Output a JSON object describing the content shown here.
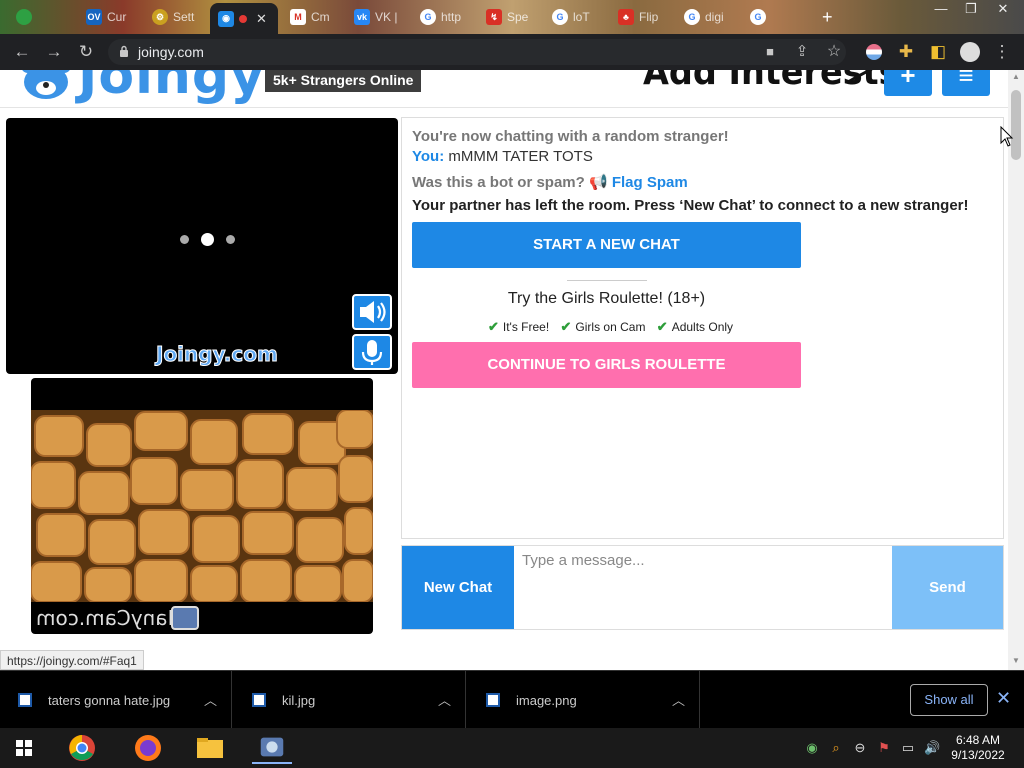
{
  "browser": {
    "tabs": [
      {
        "label": "",
        "icon": "green-dot-icon",
        "color": "#2ea043"
      },
      {
        "label": "Cur",
        "icon": "ov-icon",
        "color": "#1565c0"
      },
      {
        "label": "Sett",
        "icon": "gear-icon",
        "color": "#caa020"
      },
      {
        "label": "",
        "icon": "joingy-icon",
        "color": "#1e88e5",
        "active": true
      },
      {
        "label": "Cm",
        "icon": "mail-icon",
        "color": "#d93025"
      },
      {
        "label": "VK |",
        "icon": "vk-icon",
        "color": "#2787f5"
      },
      {
        "label": "http",
        "icon": "google-icon",
        "color": "#4285f4"
      },
      {
        "label": "Spe",
        "icon": "speed-icon",
        "color": "#d93025"
      },
      {
        "label": "loT",
        "icon": "google-icon",
        "color": "#4285f4"
      },
      {
        "label": "Flip",
        "icon": "tree-icon",
        "color": "#d93025"
      },
      {
        "label": "digi",
        "icon": "google-icon",
        "color": "#4285f4"
      },
      {
        "label": "",
        "icon": "google-icon",
        "color": "#4285f4"
      }
    ],
    "url": "joingy.com",
    "status_url": "https://joingy.com/#Faq1"
  },
  "header": {
    "logo_text": "Joingy",
    "online_badge": "5k+ Strangers Online",
    "interests_label": "Add Interests",
    "add_button": "+",
    "menu_button": "≡",
    "accent_color": "#1e88e5"
  },
  "video": {
    "watermark": "Joingy.com",
    "self_watermark": "ManyCam.com"
  },
  "chat": {
    "system_intro": "You're now chatting with a random stranger!",
    "you_label": "You:",
    "you_message": "mMMM TATER TOTS",
    "spam_question": "Was this a bot or spam?",
    "flag_spam": "Flag Spam",
    "partner_left": "Your partner has left the room. Press ‘New Chat’ to connect to a new stranger!",
    "start_new_chat": "START A NEW CHAT",
    "roulette_title": "Try the Girls Roulette! (18+)",
    "features": [
      "It's Free!",
      "Girls on Cam",
      "Adults Only"
    ],
    "continue_roulette": "CONTINUE TO GIRLS ROULETTE",
    "roulette_color": "#ff6fae"
  },
  "composer": {
    "new_chat": "New Chat",
    "placeholder": "Type a message...",
    "send": "Send"
  },
  "downloads": {
    "items": [
      "taters gonna hate.jpg",
      "kil.jpg",
      "image.png"
    ],
    "show_all": "Show all"
  },
  "taskbar": {
    "time": "6:48 AM",
    "date": "9/13/2022"
  }
}
